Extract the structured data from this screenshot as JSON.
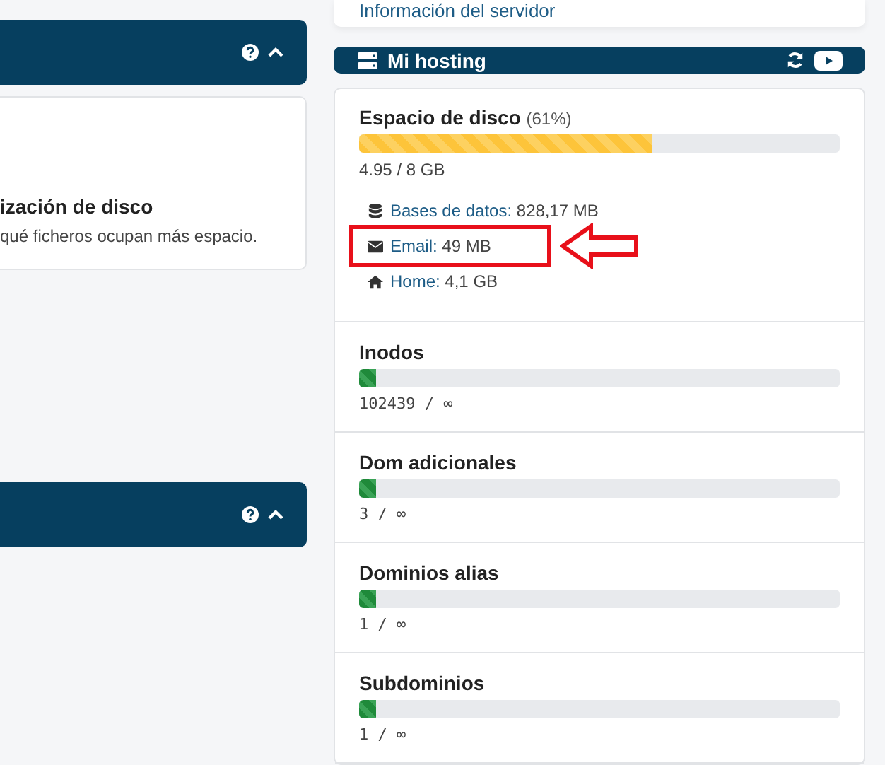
{
  "server_info_link": "Información del servidor",
  "left_card": {
    "title": "ización de disco",
    "description": "qué ficheros ocupan más espacio."
  },
  "hosting": {
    "title": "Mi hosting",
    "disk": {
      "title": "Espacio de disco",
      "percent": "(61%)",
      "level": 0.61,
      "reading": "4.95 / 8 GB",
      "items": [
        {
          "kind": "database",
          "label": "Bases de datos:",
          "value": "828,17 MB",
          "highlighted": false
        },
        {
          "kind": "email",
          "label": "Email:",
          "value": "49 MB",
          "highlighted": true
        },
        {
          "kind": "home",
          "label": "Home:",
          "value": "4,1 GB",
          "highlighted": false
        }
      ]
    },
    "meters": [
      {
        "name": "Inodos",
        "level": 0.035,
        "reading": "102439 / ∞"
      },
      {
        "name": "Dom adicionales",
        "level": 0.035,
        "reading": "3 / ∞"
      },
      {
        "name": "Dominios alias",
        "level": 0.035,
        "reading": "1 / ∞"
      },
      {
        "name": "Subdominios",
        "level": 0.035,
        "reading": "1 / ∞"
      }
    ]
  }
}
